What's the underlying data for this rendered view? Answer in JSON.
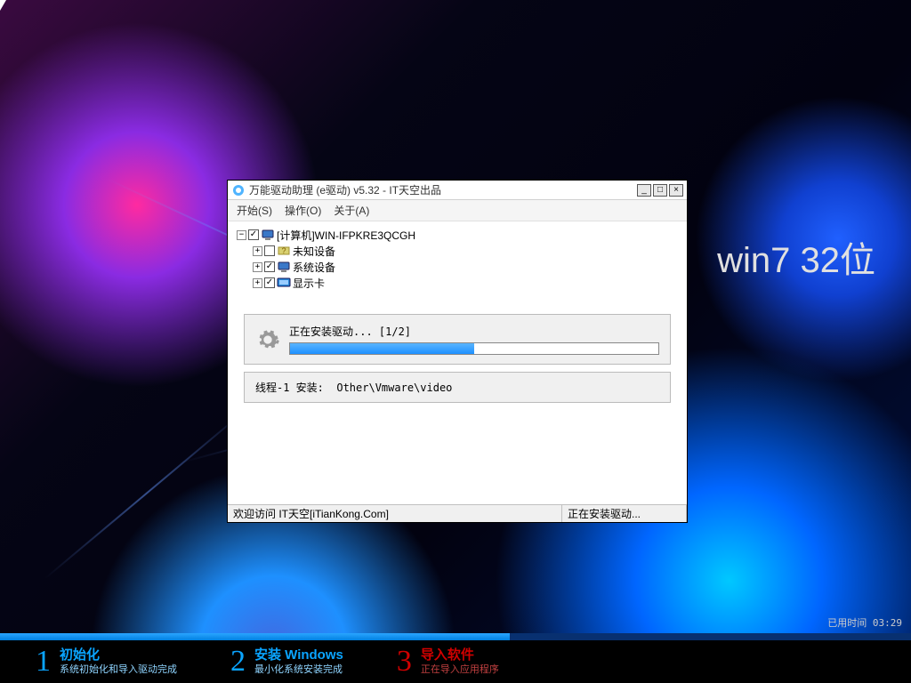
{
  "background": {
    "side_text": "win7 32位"
  },
  "window": {
    "title": "万能驱动助理 (e驱动) v5.32 - IT天空出品",
    "menu": {
      "start": "开始(S)",
      "action": "操作(O)",
      "about": "关于(A)"
    },
    "controls": {
      "min": "_",
      "max": "□",
      "close": "×"
    },
    "tree": {
      "root": {
        "toggle": "−",
        "checked": true,
        "label": "[计算机]WIN-IFPKRE3QCGH"
      },
      "n1": {
        "toggle": "+",
        "checked": false,
        "label": "未知设备"
      },
      "n2": {
        "toggle": "+",
        "checked": true,
        "label": "系统设备"
      },
      "n3": {
        "toggle": "+",
        "checked": true,
        "label": "显示卡"
      }
    },
    "progress": {
      "label": "正在安装驱动... [1/2]",
      "percent": 50
    },
    "thread": "线程-1 安装:  Other\\Vmware\\video",
    "status": {
      "left": "欢迎访问 IT天空[iTianKong.Com]",
      "right": "正在安装驱动..."
    }
  },
  "installer": {
    "elapsed_label": "已用时间",
    "elapsed_value": "03:29",
    "overall_percent": 56,
    "steps": [
      {
        "num": "1",
        "title": "初始化",
        "sub": "系统初始化和导入驱动完成",
        "style": "blue"
      },
      {
        "num": "2",
        "title": "安装 Windows",
        "sub": "最小化系统安装完成",
        "style": "blue"
      },
      {
        "num": "3",
        "title": "导入软件",
        "sub": "正在导入应用程序",
        "style": "red"
      }
    ]
  }
}
